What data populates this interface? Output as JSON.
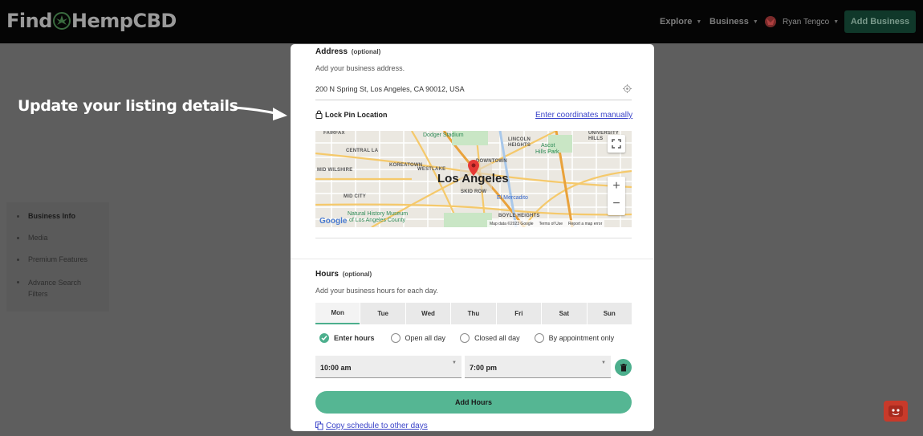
{
  "header": {
    "logo_find": "Find",
    "logo_hemp": "Hemp",
    "logo_cbd": "CBD",
    "nav": {
      "explore": "Explore",
      "business": "Business",
      "user_name": "Ryan Tengco"
    },
    "add_business_label": "Add Business"
  },
  "overlay": {
    "caption": "Update your listing details"
  },
  "sidebar": {
    "items": [
      {
        "label": "Business Info",
        "active": true
      },
      {
        "label": "Media"
      },
      {
        "label": "Premium Features"
      },
      {
        "label": "Advance Search Filters"
      }
    ]
  },
  "address": {
    "title": "Address",
    "optional": "(optional)",
    "description": "Add your business address.",
    "value": "200 N Spring St, Los Angeles, CA 90012, USA",
    "lock_label": "Lock Pin Location",
    "coords_link": "Enter coordinates manually"
  },
  "map": {
    "city": "Los Angeles",
    "labels": {
      "fairfax": "FAIRFAX",
      "central_la": "CENTRAL LA",
      "koreatown": "KOREATOWN",
      "westlake": "WESTLAKE",
      "mid_wilshire": "MID WILSHIRE",
      "mid_city": "MID CITY",
      "downtown": "DOWNTOWN",
      "skid_row": "SKID ROW",
      "lincoln_heights": "LINCOLN",
      "heights": "HEIGHTS",
      "boyle_heights": "BOYLE HEIGHTS",
      "university": "UNIVERSITY",
      "hills": "HILLS",
      "ascot": "Ascot",
      "ascot_hills": "Hills Park",
      "dodger": "Dodger Stadium",
      "el_mercadito": "El Mercadito",
      "nhm_line1": "Natural History Museum",
      "nhm_line2": "of Los Angeles County"
    },
    "footer": {
      "data": "Map data ©2023 Google",
      "terms": "Terms of Use",
      "report": "Report a map error"
    },
    "google": "Google"
  },
  "hours": {
    "title": "Hours",
    "optional": "(optional)",
    "description": "Add your business hours for each day.",
    "days": [
      "Mon",
      "Tue",
      "Wed",
      "Thu",
      "Fri",
      "Sat",
      "Sun"
    ],
    "options": {
      "enter_hours": "Enter hours",
      "open_all_day": "Open all day",
      "closed_all_day": "Closed all day",
      "by_appointment": "By appointment only"
    },
    "start_time": "10:00 am",
    "end_time": "7:00 pm",
    "add_hours_label": "Add Hours",
    "copy_link": "Copy schedule to other days"
  },
  "colors": {
    "accent": "#4caf8d",
    "link": "#3b44c9",
    "header_bg": "#050505"
  }
}
